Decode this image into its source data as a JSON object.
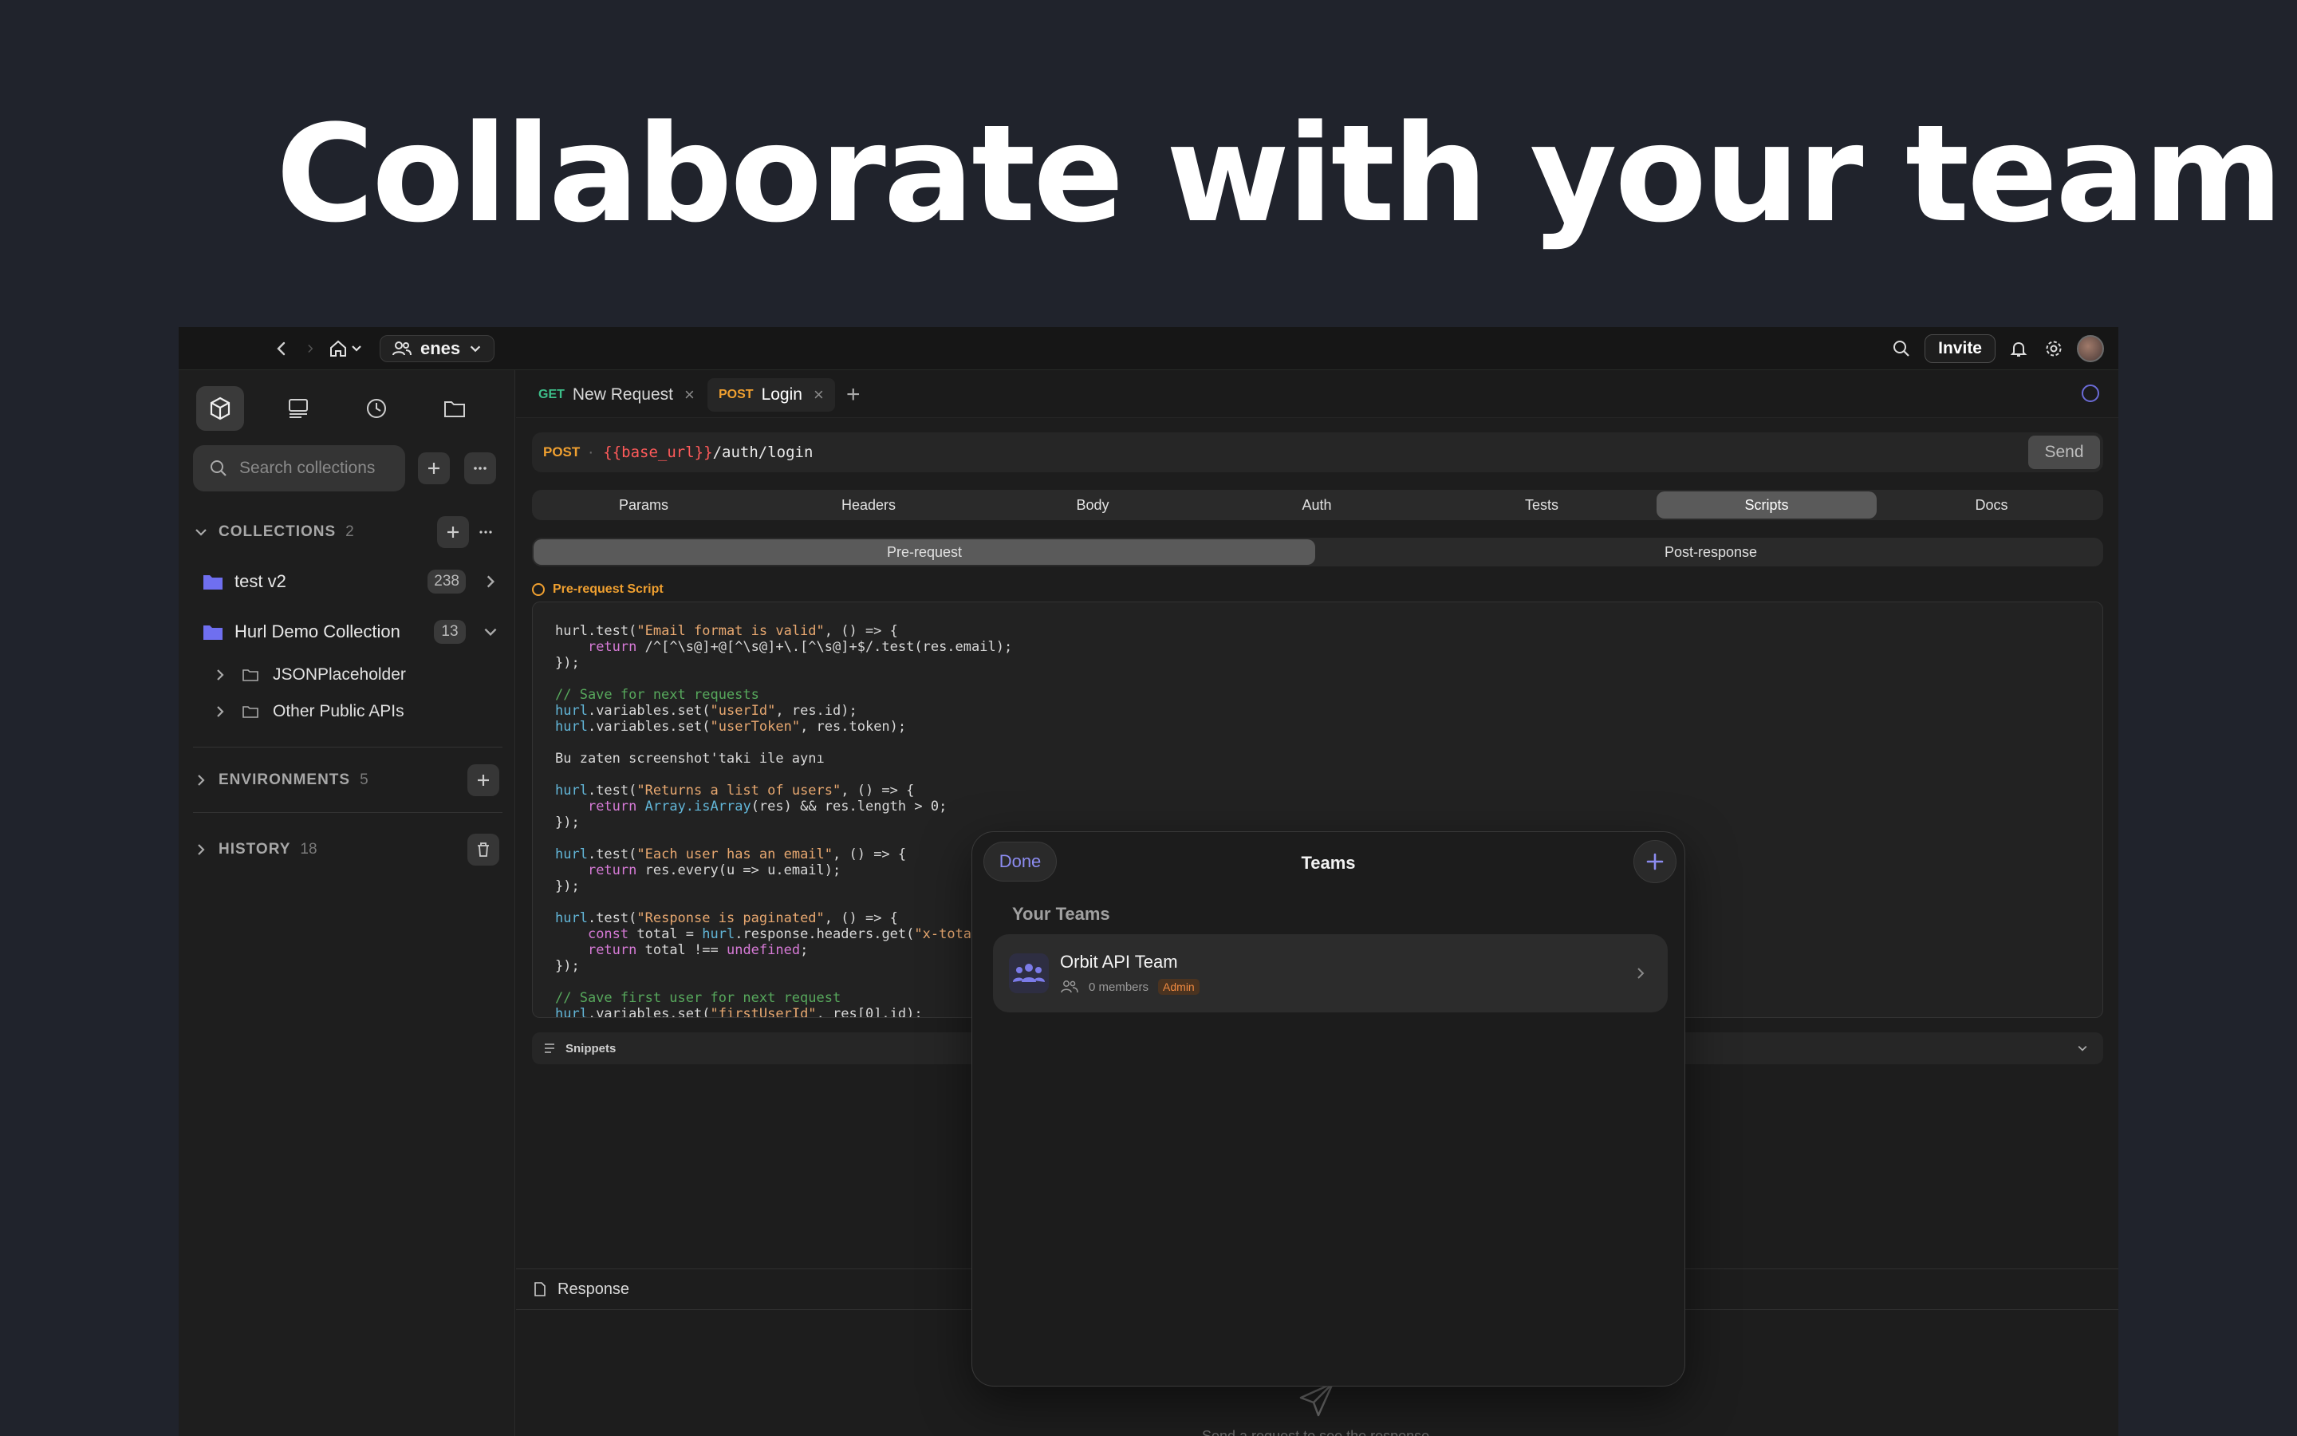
{
  "headline": "Collaborate with your team",
  "topbar": {
    "workspace_name": "enes",
    "invite_label": "Invite"
  },
  "sidebar": {
    "search_placeholder": "Search collections",
    "collections_label": "COLLECTIONS",
    "collections_count": "2",
    "collections": [
      {
        "name": "test v2",
        "count": "238"
      },
      {
        "name": "Hurl Demo Collection",
        "count": "13"
      }
    ],
    "subfolders": [
      "JSONPlaceholder",
      "Other Public APIs"
    ],
    "environments_label": "ENVIRONMENTS",
    "environments_count": "5",
    "history_label": "HISTORY",
    "history_count": "18"
  },
  "tabs": [
    {
      "method": "GET",
      "name": "New Request"
    },
    {
      "method": "POST",
      "name": "Login"
    }
  ],
  "request": {
    "method": "POST",
    "url_var": "{{base_url}}",
    "url_path": "/auth/login",
    "send_label": "Send",
    "segments": [
      "Params",
      "Headers",
      "Body",
      "Auth",
      "Tests",
      "Scripts",
      "Docs"
    ],
    "active_segment": "Scripts",
    "subsegments": [
      "Pre-request",
      "Post-response"
    ],
    "pre_request_label": "Pre-request Script",
    "snippets_label": "Snippets"
  },
  "response": {
    "label": "Response",
    "hint": "Send a request to see the response"
  },
  "modal": {
    "done_label": "Done",
    "title": "Teams",
    "section_label": "Your Teams",
    "teams": [
      {
        "name": "Orbit API Team",
        "members": "0 members",
        "role": "Admin"
      }
    ]
  },
  "colors": {
    "background": "#20232c",
    "accent": "#8c8cf0",
    "post": "#f0a030",
    "get": "#3dbf8a"
  }
}
